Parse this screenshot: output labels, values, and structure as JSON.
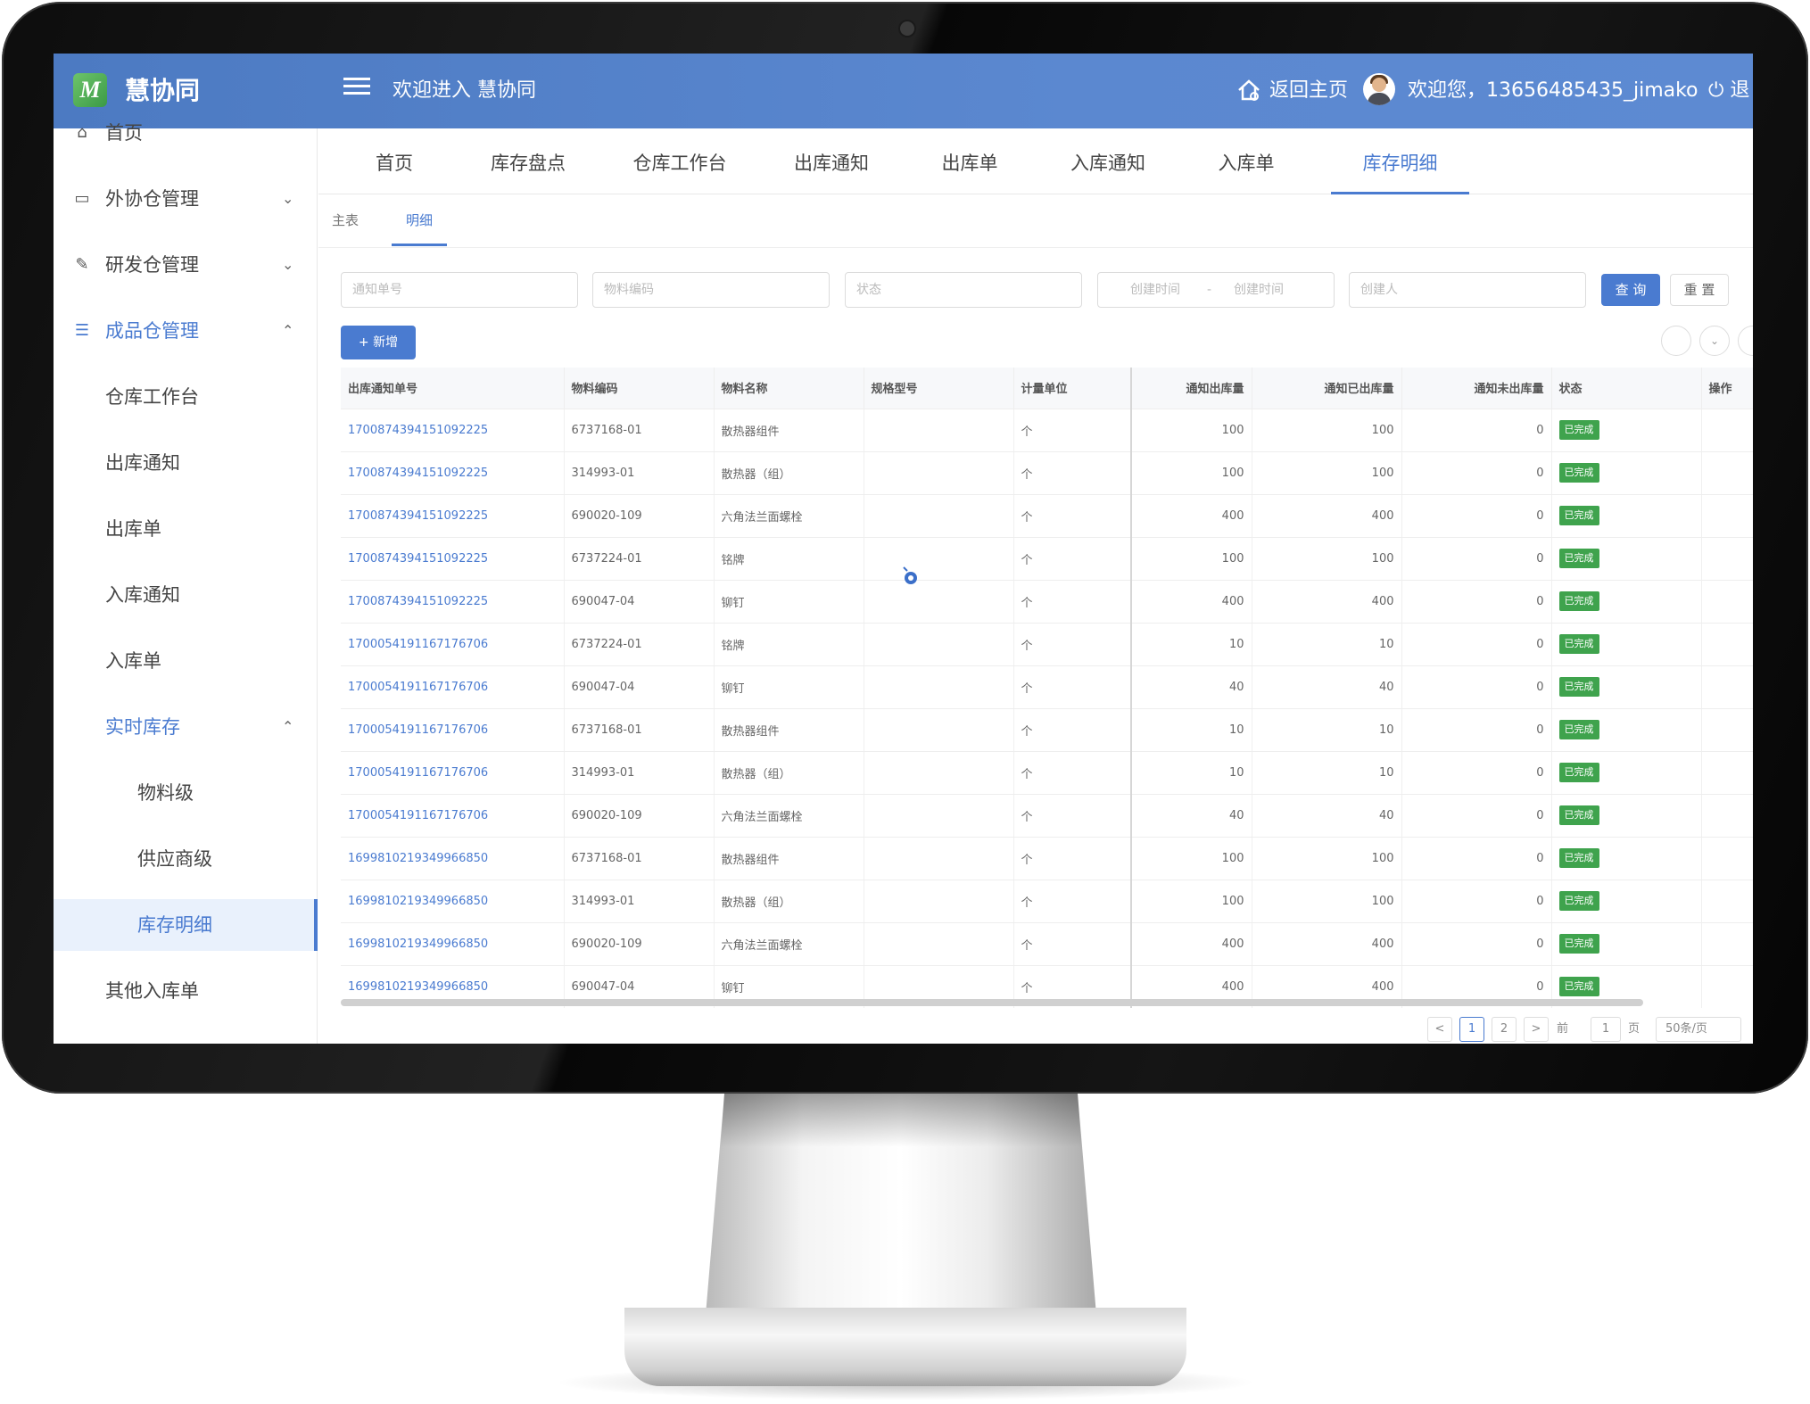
{
  "app": {
    "logo_letter": "M",
    "name": "慧协同",
    "welcome": "欢迎进入 慧协同",
    "home_link": "返回主页",
    "user_text": "欢迎您，13656485435_jimako",
    "logout": "退"
  },
  "sidebar": {
    "items": [
      {
        "label": "首页",
        "icon": "home-icon"
      },
      {
        "label": "外协仓管理",
        "icon": "box-icon",
        "expand": "collapsed"
      },
      {
        "label": "研发仓管理",
        "icon": "pencil-icon",
        "expand": "collapsed"
      },
      {
        "label": "成品仓管理",
        "icon": "list-icon",
        "expand": "expanded"
      },
      {
        "label": "仓库工作台"
      },
      {
        "label": "出库通知"
      },
      {
        "label": "出库单"
      },
      {
        "label": "入库通知"
      },
      {
        "label": "入库单"
      },
      {
        "label": "实时库存",
        "expand": "expanded"
      },
      {
        "label": "物料级"
      },
      {
        "label": "供应商级"
      },
      {
        "label": "库存明细"
      },
      {
        "label": "其他入库单"
      }
    ]
  },
  "tabs": [
    "首页",
    "库存盘点",
    "仓库工作台",
    "出库通知",
    "出库单",
    "入库通知",
    "入库单",
    "库存明细"
  ],
  "active_tab": "库存明细",
  "subtabs": [
    "主表",
    "明细"
  ],
  "filters": {
    "notice_no": "通知单号",
    "material_code": "物料编码",
    "status": "状态",
    "date_start": "创建时间",
    "date_sep": "-",
    "date_end": "创建时间",
    "creator": "创建人",
    "query": "查 询",
    "reset": "重 置"
  },
  "add_button": "+ 新增",
  "table": {
    "columns": [
      "出库通知单号",
      "物料编码",
      "物料名称",
      "规格型号",
      "计量单位",
      "通知出库量",
      "通知已出库量",
      "通知未出库量",
      "状态",
      "操作"
    ],
    "rows": [
      [
        "1700874394151092225",
        "6737168-01",
        "散热器组件",
        "",
        "个",
        "100",
        "100",
        "0",
        "已完成"
      ],
      [
        "1700874394151092225",
        "314993-01",
        "散热器（组）",
        "",
        "个",
        "100",
        "100",
        "0",
        "已完成"
      ],
      [
        "1700874394151092225",
        "690020-109",
        "六角法兰面螺栓",
        "",
        "个",
        "400",
        "400",
        "0",
        "已完成"
      ],
      [
        "1700874394151092225",
        "6737224-01",
        "铭牌",
        "",
        "个",
        "100",
        "100",
        "0",
        "已完成"
      ],
      [
        "1700874394151092225",
        "690047-04",
        "铆钉",
        "",
        "个",
        "400",
        "400",
        "0",
        "已完成"
      ],
      [
        "1700054191167176706",
        "6737224-01",
        "铭牌",
        "",
        "个",
        "10",
        "10",
        "0",
        "已完成"
      ],
      [
        "1700054191167176706",
        "690047-04",
        "铆钉",
        "",
        "个",
        "40",
        "40",
        "0",
        "已完成"
      ],
      [
        "1700054191167176706",
        "6737168-01",
        "散热器组件",
        "",
        "个",
        "10",
        "10",
        "0",
        "已完成"
      ],
      [
        "1700054191167176706",
        "314993-01",
        "散热器（组）",
        "",
        "个",
        "10",
        "10",
        "0",
        "已完成"
      ],
      [
        "1700054191167176706",
        "690020-109",
        "六角法兰面螺栓",
        "",
        "个",
        "40",
        "40",
        "0",
        "已完成"
      ],
      [
        "1699810219349966850",
        "6737168-01",
        "散热器组件",
        "",
        "个",
        "100",
        "100",
        "0",
        "已完成"
      ],
      [
        "1699810219349966850",
        "314993-01",
        "散热器（组）",
        "",
        "个",
        "100",
        "100",
        "0",
        "已完成"
      ],
      [
        "1699810219349966850",
        "690020-109",
        "六角法兰面螺栓",
        "",
        "个",
        "400",
        "400",
        "0",
        "已完成"
      ],
      [
        "1699810219349966850",
        "690047-04",
        "铆钉",
        "",
        "个",
        "400",
        "400",
        "0",
        "已完成"
      ]
    ]
  },
  "pagination": {
    "prev": "<",
    "pages": [
      "1",
      "2"
    ],
    "current": "1",
    "next": ">",
    "goto_label": "前往",
    "goto_value": "1",
    "page_suffix": "页",
    "page_size": "50条/页"
  },
  "colors": {
    "primary": "#4a7bd0",
    "header": "#5b88d0",
    "success": "#3fa34d"
  }
}
